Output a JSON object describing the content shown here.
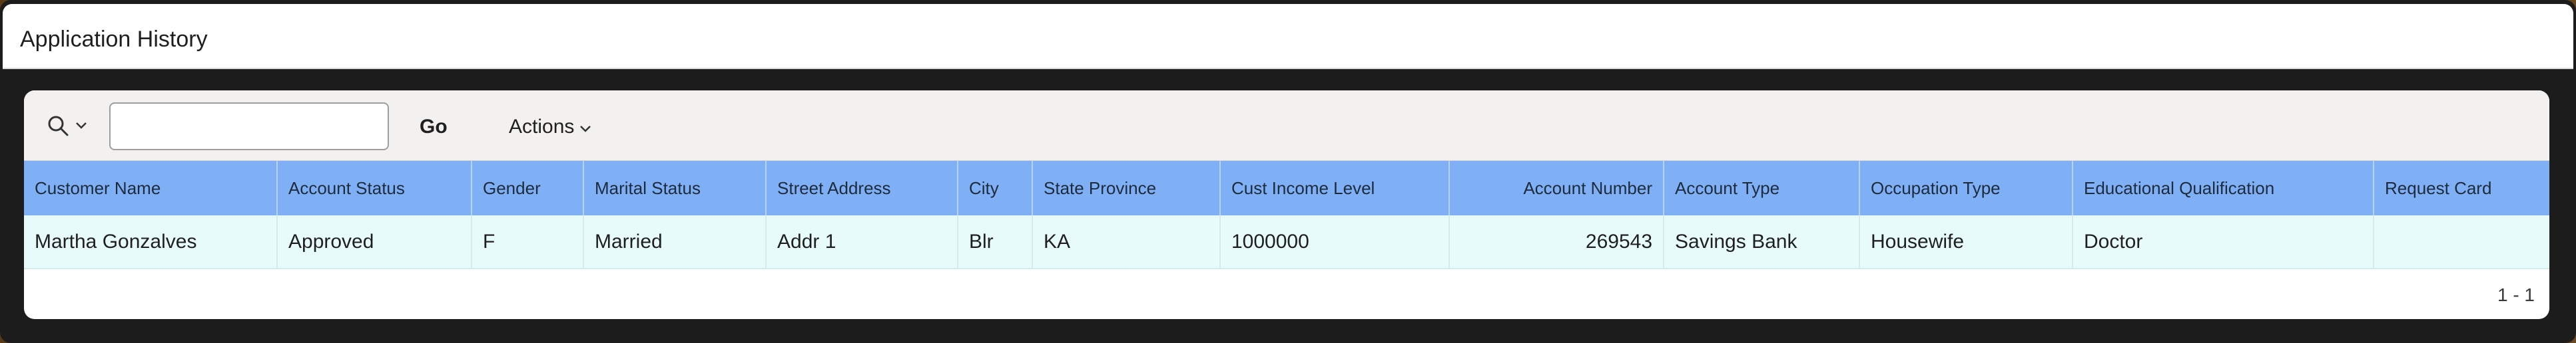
{
  "page": {
    "title": "Application History"
  },
  "toolbar": {
    "search_icon": "search-icon",
    "chevron_icon": "chevron-down-icon",
    "search_value": "",
    "go_label": "Go",
    "actions_label": "Actions"
  },
  "table": {
    "columns": [
      "Customer Name",
      "Account Status",
      "Gender",
      "Marital Status",
      "Street Address",
      "City",
      "State Province",
      "Cust Income Level",
      "Account Number",
      "Account Type",
      "Occupation Type",
      "Educational Qualification",
      "Request Card"
    ],
    "rows": [
      [
        "Martha Gonzalves",
        "Approved",
        "F",
        "Married",
        "Addr 1",
        "Blr",
        "KA",
        "1000000",
        "269543",
        "Savings Bank",
        "Housewife",
        "Doctor",
        ""
      ]
    ]
  },
  "pagination": {
    "label": "1 - 1"
  },
  "colors": {
    "header_bg": "#7fb0f5",
    "row_bg": "#e8fbfb",
    "toolbar_bg": "#f2f1ef"
  }
}
